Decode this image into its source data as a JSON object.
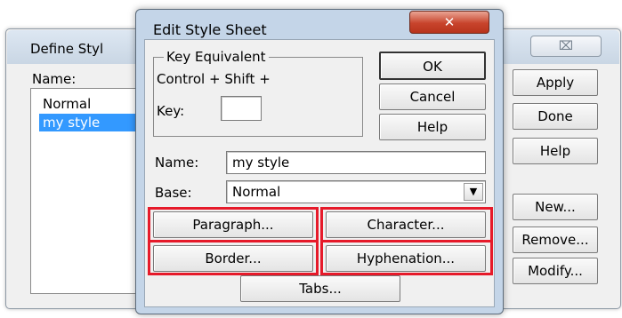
{
  "define_window": {
    "title": "Define Styl",
    "close_glyph": "⌧",
    "name_label": "Name:",
    "list_items": [
      {
        "label": "Normal",
        "selected": false
      },
      {
        "label": "my style",
        "selected": true
      }
    ],
    "buttons": [
      "Apply",
      "Done",
      "Help",
      "New...",
      "Remove...",
      "Modify..."
    ]
  },
  "edit_dialog": {
    "title": "Edit Style Sheet",
    "close_glyph": "✕",
    "key_equivalent": {
      "legend": "Key Equivalent",
      "modifier_text": "Control + Shift +",
      "key_label": "Key:",
      "key_value": ""
    },
    "ok_label": "OK",
    "cancel_label": "Cancel",
    "help_label": "Help",
    "name_label": "Name:",
    "name_value": "my style",
    "base_label": "Base:",
    "base_value": "Normal",
    "paragraph_label": "Paragraph...",
    "character_label": "Character...",
    "border_label": "Border...",
    "hyphenation_label": "Hyphenation...",
    "tabs_label": "Tabs..."
  },
  "highlight_color": "#e61a2a"
}
